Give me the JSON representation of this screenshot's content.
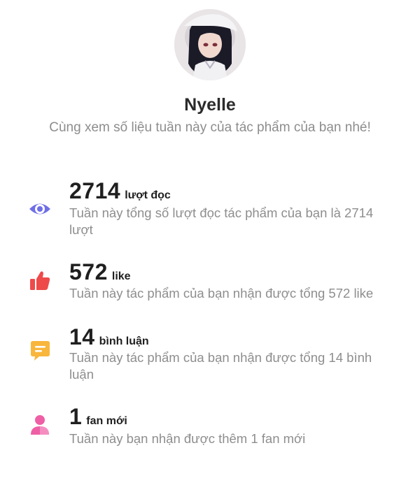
{
  "profile": {
    "name": "Nyelle",
    "subtitle": "Cùng xem số liệu tuần này của tác phẩm của bạn nhé!",
    "avatar_icon": "user-avatar"
  },
  "stats": [
    {
      "icon": "eye-icon",
      "icon_color": "#6f6ee8",
      "number": "2714",
      "unit": "lượt đọc",
      "description": "Tuần này tổng số lượt đọc tác phẩm của bạn là 2714 lượt"
    },
    {
      "icon": "thumbs-up-icon",
      "icon_color": "#ee4a4a",
      "number": "572",
      "unit": "like",
      "description": "Tuần này tác phẩm của bạn nhận được tổng 572 like"
    },
    {
      "icon": "comment-icon",
      "icon_color": "#f8b63c",
      "number": "14",
      "unit": "bình luận",
      "description": "Tuần này tác phẩm của bạn nhận được tổng 14 bình luận"
    },
    {
      "icon": "person-icon",
      "icon_color": "#ef5fa6",
      "number": "1",
      "unit": "fan mới",
      "description": "Tuần này bạn nhận được thêm 1 fan mới"
    }
  ]
}
